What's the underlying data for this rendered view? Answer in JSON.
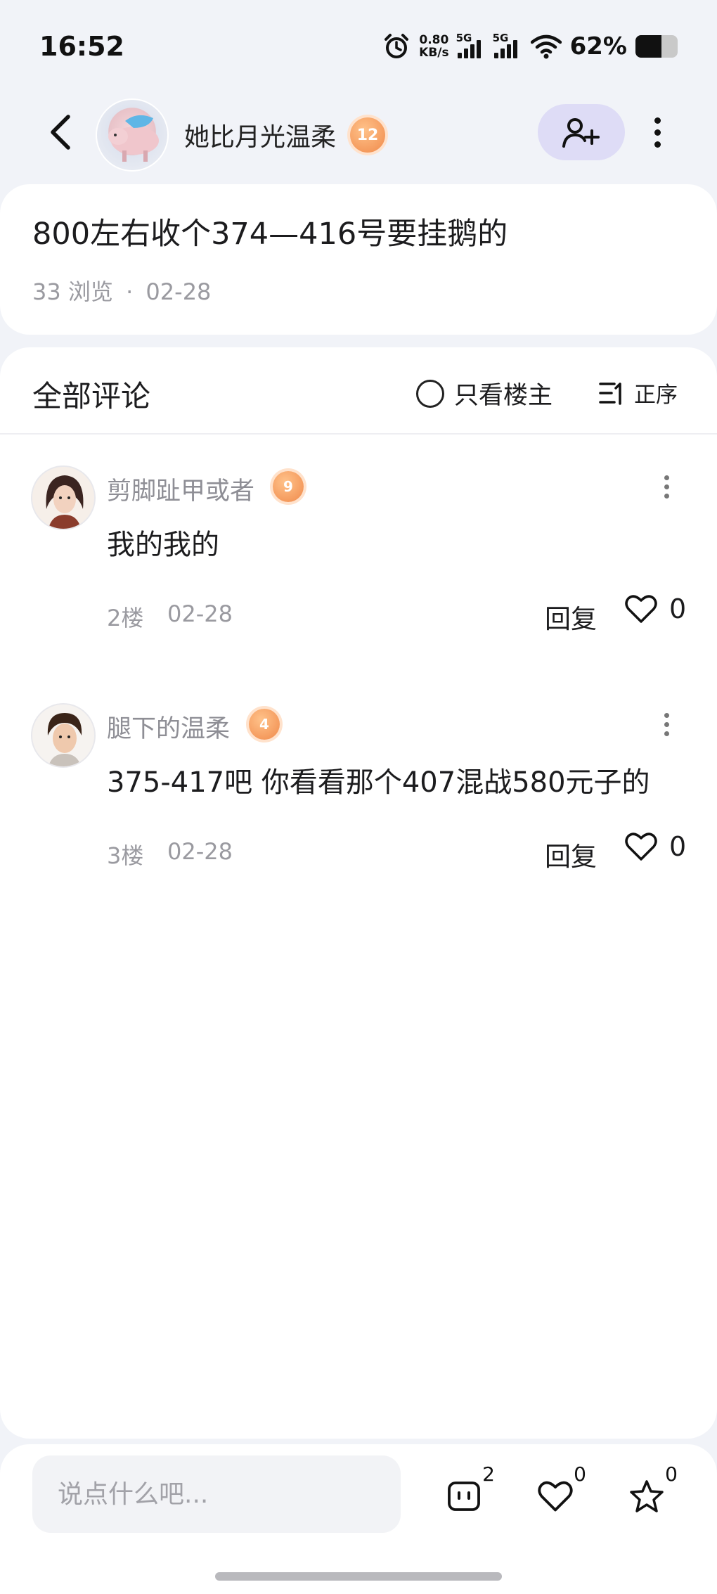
{
  "status_bar": {
    "time": "16:52",
    "net_speed_value": "0.80",
    "net_speed_unit": "KB/s",
    "signal_1_label": "5G",
    "signal_2_label": "5G",
    "battery_percent_text": "62%",
    "battery_level": 0.62,
    "icons": [
      "alarm-icon",
      "signal-icon",
      "signal-icon",
      "wifi-icon",
      "battery-icon"
    ]
  },
  "header": {
    "author_name": "她比月光温柔",
    "author_level": "12",
    "icons": [
      "back-icon",
      "add-friend-icon",
      "more-vertical-icon"
    ]
  },
  "post": {
    "title": "800左右收个374—416号要挂鹅的",
    "views": "33 浏览",
    "separator": "·",
    "date": "02-28"
  },
  "comments_section": {
    "title": "全部评论",
    "only_op_label": "只看楼主",
    "sort_label": "正序",
    "comments": [
      {
        "user": "剪脚趾甲或者",
        "level": "9",
        "text": "我的我的",
        "floor": "2楼",
        "date": "02-28",
        "reply_label": "回复",
        "likes": "0"
      },
      {
        "user": "腿下的温柔",
        "level": "4",
        "text": "375-417吧 你看看那个407混战580元子的",
        "floor": "3楼",
        "date": "02-28",
        "reply_label": "回复",
        "likes": "0"
      }
    ]
  },
  "bottom_bar": {
    "input_placeholder": "说点什么吧...",
    "comment_count": "2",
    "like_count": "0",
    "favorite_count": "0"
  },
  "colors": {
    "page_background": "#f1f3f8",
    "follow_button_bg": "#dedcf6",
    "level_badge": "#f08a4b",
    "muted_text": "#9a9aa0"
  }
}
